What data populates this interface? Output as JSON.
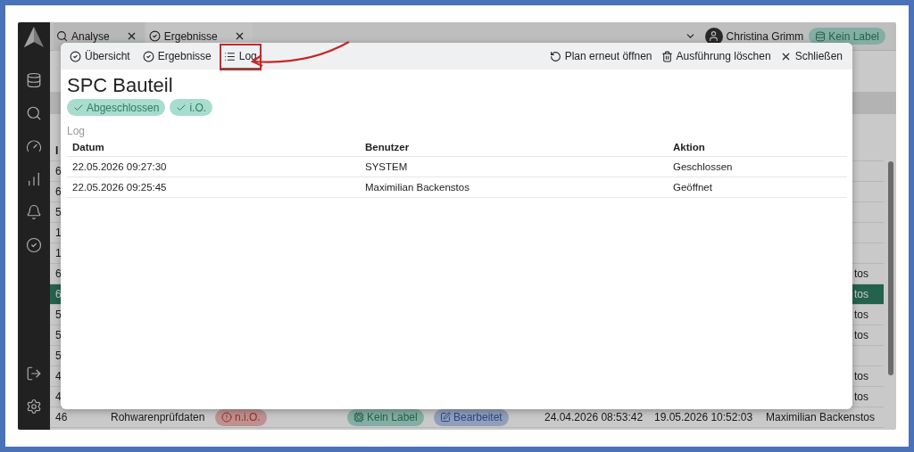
{
  "app_tabs": [
    {
      "label": "Analyse",
      "kind": "search",
      "selected": false
    },
    {
      "label": "Ergebnisse",
      "kind": "check",
      "selected": true
    }
  ],
  "user": {
    "name": "Christina Grimm",
    "label": "Kein Label"
  },
  "background_table": {
    "header_fragment": "I",
    "rows": [
      {
        "id_fragment": "6",
        "end_fragment": "",
        "selected": false
      },
      {
        "id_fragment": "6",
        "end_fragment": "",
        "selected": false
      },
      {
        "id_fragment": "5",
        "end_fragment": "",
        "selected": false
      },
      {
        "id_fragment": "1",
        "end_fragment": "",
        "selected": false
      },
      {
        "id_fragment": "1",
        "end_fragment": "",
        "selected": false
      },
      {
        "id_fragment": "6",
        "end_fragment": "tos",
        "selected": false
      },
      {
        "id_fragment": "6",
        "end_fragment": "tos",
        "selected": true
      },
      {
        "id_fragment": "5",
        "end_fragment": "tos",
        "selected": false
      },
      {
        "id_fragment": "5",
        "end_fragment": "tos",
        "selected": false
      },
      {
        "id_fragment": "5",
        "end_fragment": "",
        "selected": false
      },
      {
        "id_fragment": "4",
        "end_fragment": "tos",
        "selected": false
      },
      {
        "id_fragment": "4",
        "end_fragment": "tos",
        "selected": false
      }
    ],
    "last_row": {
      "id": "46",
      "name": "Rohwarenprüfdaten",
      "result": "n.i.O.",
      "label": "Kein Label",
      "status": "Bearbeitet",
      "created": "24.04.2026 08:53:42",
      "modified": "19.05.2026 10:52:03",
      "user": "Maximilian Backenstos"
    }
  },
  "dialog": {
    "tabs": [
      {
        "label": "Übersicht",
        "kind": "check",
        "selected": false,
        "highlighted": false
      },
      {
        "label": "Ergebnisse",
        "kind": "check",
        "selected": false,
        "highlighted": false
      },
      {
        "label": "Log",
        "kind": "list",
        "selected": true,
        "highlighted": true
      }
    ],
    "actions": [
      {
        "label": "Plan erneut öffnen",
        "kind": "reopen"
      },
      {
        "label": "Ausführung löschen",
        "kind": "delete"
      },
      {
        "label": "Schließen",
        "kind": "close"
      }
    ],
    "title": "SPC Bauteil",
    "badges": [
      "Abgeschlossen",
      "i.O."
    ],
    "section": "Log",
    "columns": [
      "Datum",
      "Benutzer",
      "Aktion"
    ],
    "rows": [
      [
        "22.05.2026 09:27:30",
        "SYSTEM",
        "Geschlossen"
      ],
      [
        "22.05.2026 09:25:45",
        "Maximilian Backenstos",
        "Geöffnet"
      ]
    ]
  }
}
